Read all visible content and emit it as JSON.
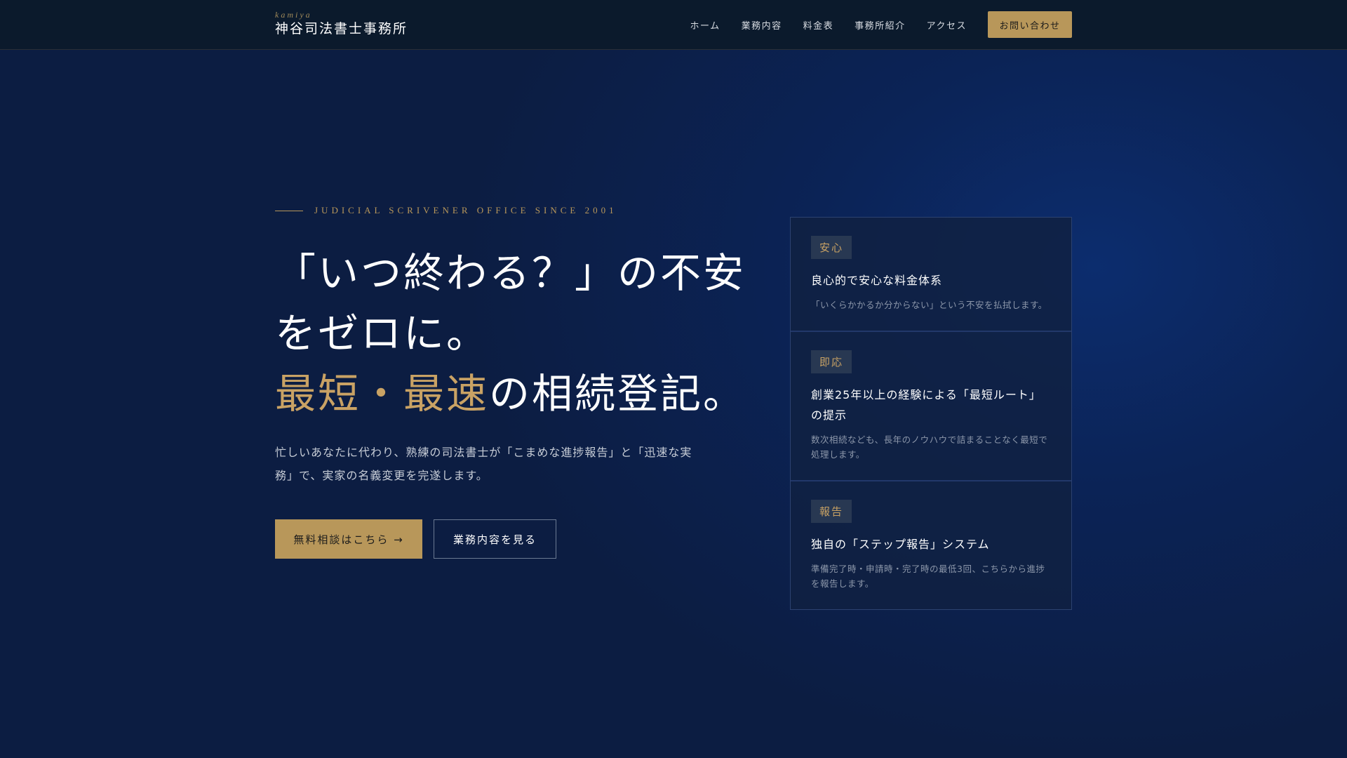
{
  "header": {
    "logo_sub": "kamiya",
    "logo_main": "神谷司法書士事務所",
    "nav": [
      "ホーム",
      "業務内容",
      "料金表",
      "事務所紹介",
      "アクセス"
    ],
    "cta": "お問い合わせ"
  },
  "hero": {
    "eyebrow": "JUDICIAL SCRIVENER OFFICE SINCE 2001",
    "headline_1": "「いつ終わる？」の不安をゼロに。",
    "headline_gold_1": "最短",
    "headline_sep": "・",
    "headline_gold_2": "最速",
    "headline_end": "の相続登記。",
    "lead": "忙しいあなたに代わり、熟練の司法書士が「こまめな進捗報告」と「迅速な実務」で、実家の名義変更を完遂します。",
    "primary_button": "無料相談はこちら →",
    "secondary_button": "業務内容を見る"
  },
  "cards": [
    {
      "badge": "安心",
      "title": "良心的で安心な料金体系",
      "desc": "「いくらかかるか分からない」という不安を払拭します。"
    },
    {
      "badge": "即応",
      "title": "創業25年以上の経験による「最短ルート」の提示",
      "desc": "数次相続なども、長年のノウハウで詰まることなく最短で処理します。"
    },
    {
      "badge": "報告",
      "title": "独自の「ステップ報告」システム",
      "desc": "準備完了時・申請時・完了時の最低3回、こちらから進捗を報告します。"
    }
  ]
}
